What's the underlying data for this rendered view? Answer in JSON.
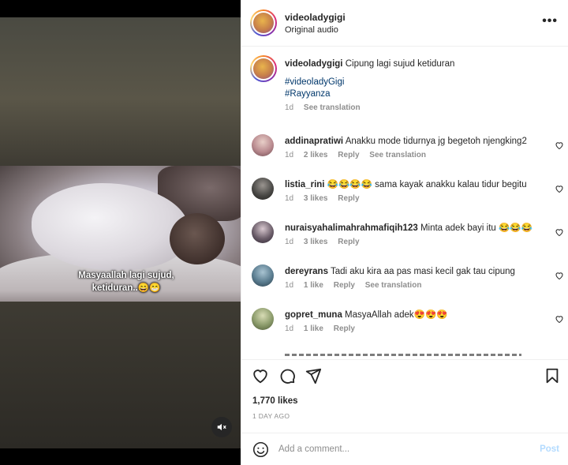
{
  "post": {
    "username": "videoladygigi",
    "audio": "Original audio",
    "more_label": "•••",
    "caption_text": "Cipung lagi sujud ketiduran",
    "hashtags": [
      "#videoladyGigi",
      "#Rayyanza"
    ],
    "caption_time": "1d",
    "see_translation": "See translation"
  },
  "media": {
    "caption_line1": "Masyaallah lagi sujud,",
    "caption_line2": "ketiduran..😄😁",
    "mute_icon": "speaker-muted-icon"
  },
  "comments": [
    {
      "username": "addinapratiwi",
      "text": "Anakku mode tidurnya jg begetoh njengking2",
      "time": "1d",
      "likes": "2 likes",
      "reply": "Reply",
      "see_translation": "See translation",
      "avatar_color": "#b98a8f"
    },
    {
      "username": "listia_rini",
      "text": "😂😂😂😂 sama kayak anakku kalau tidur begitu",
      "time": "1d",
      "likes": "3 likes",
      "reply": "Reply",
      "avatar_color": "#4b4a47"
    },
    {
      "username": "nuraisyahalimahrahmafiqih123",
      "text": "Minta adek bayi itu 😂😂😂",
      "time": "1d",
      "likes": "3 likes",
      "reply": "Reply",
      "avatar_color": "#6c5e6a"
    },
    {
      "username": "dereyrans",
      "text": "Tadi aku kira aa pas masi kecil gak tau cipung",
      "time": "1d",
      "likes": "1 like",
      "reply": "Reply",
      "see_translation": "See translation",
      "avatar_color": "#5a7c8f"
    },
    {
      "username": "gopret_muna",
      "text": "MasyaAllah adek😍😍😍",
      "time": "1d",
      "likes": "1 like",
      "reply": "Reply",
      "avatar_color": "#8a9a6a"
    }
  ],
  "actions": {
    "likes_count": "1,770 likes",
    "date": "1 DAY AGO"
  },
  "add_comment": {
    "placeholder": "Add a comment...",
    "post_label": "Post"
  }
}
